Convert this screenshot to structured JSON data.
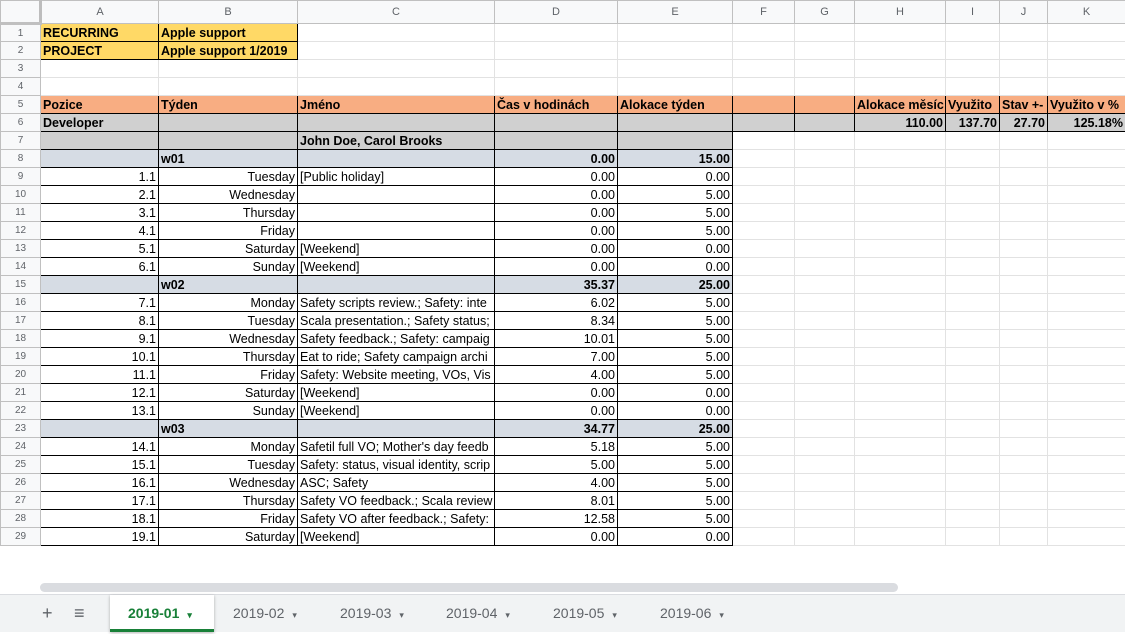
{
  "columns": [
    "A",
    "B",
    "C",
    "D",
    "E",
    "F",
    "G",
    "H",
    "I",
    "J",
    "K"
  ],
  "rows": [
    {
      "n": "1",
      "cells": [
        {
          "t": "RECURRING",
          "cls": "yel bx"
        },
        {
          "t": "Apple support",
          "cls": "yel bx"
        },
        {
          "t": ""
        },
        {
          "t": ""
        },
        {
          "t": ""
        },
        {
          "t": ""
        },
        {
          "t": ""
        },
        {
          "t": ""
        },
        {
          "t": ""
        },
        {
          "t": ""
        },
        {
          "t": ""
        }
      ]
    },
    {
      "n": "2",
      "cells": [
        {
          "t": "PROJECT",
          "cls": "yel bx"
        },
        {
          "t": "Apple support 1/2019",
          "cls": "yel bx"
        },
        {
          "t": ""
        },
        {
          "t": ""
        },
        {
          "t": ""
        },
        {
          "t": ""
        },
        {
          "t": ""
        },
        {
          "t": ""
        },
        {
          "t": ""
        },
        {
          "t": ""
        },
        {
          "t": ""
        }
      ]
    },
    {
      "n": "3",
      "cells": [
        {
          "t": ""
        },
        {
          "t": ""
        },
        {
          "t": ""
        },
        {
          "t": ""
        },
        {
          "t": ""
        },
        {
          "t": ""
        },
        {
          "t": ""
        },
        {
          "t": ""
        },
        {
          "t": ""
        },
        {
          "t": ""
        },
        {
          "t": ""
        }
      ]
    },
    {
      "n": "4",
      "cells": [
        {
          "t": ""
        },
        {
          "t": ""
        },
        {
          "t": ""
        },
        {
          "t": ""
        },
        {
          "t": ""
        },
        {
          "t": ""
        },
        {
          "t": ""
        },
        {
          "t": ""
        },
        {
          "t": ""
        },
        {
          "t": ""
        },
        {
          "t": ""
        }
      ]
    },
    {
      "n": "5",
      "cells": [
        {
          "t": "Pozice",
          "cls": "org bx"
        },
        {
          "t": "Týden",
          "cls": "org bx"
        },
        {
          "t": "Jméno",
          "cls": "org bx"
        },
        {
          "t": "Čas v hodinách",
          "cls": "org bx"
        },
        {
          "t": "Alokace týden",
          "cls": "org bx"
        },
        {
          "t": "",
          "cls": "org bx"
        },
        {
          "t": "",
          "cls": "org bx"
        },
        {
          "t": "Alokace měsíc",
          "cls": "org bx"
        },
        {
          "t": "Využito",
          "cls": "org bx"
        },
        {
          "t": "Stav +-",
          "cls": "org bx"
        },
        {
          "t": "Využito v %",
          "cls": "org bx"
        }
      ]
    },
    {
      "n": "6",
      "cells": [
        {
          "t": "Developer",
          "cls": "gry bx"
        },
        {
          "t": "",
          "cls": "gry bx"
        },
        {
          "t": "",
          "cls": "gry bx"
        },
        {
          "t": "",
          "cls": "gry bx"
        },
        {
          "t": "",
          "cls": "gry bx"
        },
        {
          "t": "",
          "cls": "gry bx"
        },
        {
          "t": "",
          "cls": "gry bx"
        },
        {
          "t": "110.00",
          "cls": "gry bx r"
        },
        {
          "t": "137.70",
          "cls": "gry bx r"
        },
        {
          "t": "27.70",
          "cls": "gry bx r"
        },
        {
          "t": "125.18%",
          "cls": "gry bx r"
        }
      ]
    },
    {
      "n": "7",
      "cells": [
        {
          "t": "",
          "cls": "gry bx"
        },
        {
          "t": "",
          "cls": "gry bx"
        },
        {
          "t": "John Doe, Carol Brooks",
          "cls": "gry bx"
        },
        {
          "t": "",
          "cls": "gry bx"
        },
        {
          "t": "",
          "cls": "gry bx"
        },
        {
          "t": ""
        },
        {
          "t": ""
        },
        {
          "t": ""
        },
        {
          "t": ""
        },
        {
          "t": ""
        },
        {
          "t": ""
        }
      ]
    },
    {
      "n": "8",
      "cells": [
        {
          "t": "",
          "cls": "wk bx"
        },
        {
          "t": "w01",
          "cls": "wk bx"
        },
        {
          "t": "",
          "cls": "wk bx"
        },
        {
          "t": "0.00",
          "cls": "wk bx r"
        },
        {
          "t": "15.00",
          "cls": "wk bx r"
        },
        {
          "t": ""
        },
        {
          "t": ""
        },
        {
          "t": ""
        },
        {
          "t": ""
        },
        {
          "t": ""
        },
        {
          "t": ""
        }
      ]
    },
    {
      "n": "9",
      "cells": [
        {
          "t": "1.1",
          "cls": "bx r"
        },
        {
          "t": "Tuesday",
          "cls": "bx r"
        },
        {
          "t": "[Public holiday]",
          "cls": "bx"
        },
        {
          "t": "0.00",
          "cls": "bx r"
        },
        {
          "t": "0.00",
          "cls": "bx r"
        },
        {
          "t": ""
        },
        {
          "t": ""
        },
        {
          "t": ""
        },
        {
          "t": ""
        },
        {
          "t": ""
        },
        {
          "t": ""
        }
      ]
    },
    {
      "n": "10",
      "cells": [
        {
          "t": "2.1",
          "cls": "bx r"
        },
        {
          "t": "Wednesday",
          "cls": "bx r"
        },
        {
          "t": "",
          "cls": "bx"
        },
        {
          "t": "0.00",
          "cls": "bx r"
        },
        {
          "t": "5.00",
          "cls": "bx r"
        },
        {
          "t": ""
        },
        {
          "t": ""
        },
        {
          "t": ""
        },
        {
          "t": ""
        },
        {
          "t": ""
        },
        {
          "t": ""
        }
      ]
    },
    {
      "n": "11",
      "cells": [
        {
          "t": "3.1",
          "cls": "bx r"
        },
        {
          "t": "Thursday",
          "cls": "bx r"
        },
        {
          "t": "",
          "cls": "bx"
        },
        {
          "t": "0.00",
          "cls": "bx r"
        },
        {
          "t": "5.00",
          "cls": "bx r"
        },
        {
          "t": ""
        },
        {
          "t": ""
        },
        {
          "t": ""
        },
        {
          "t": ""
        },
        {
          "t": ""
        },
        {
          "t": ""
        }
      ]
    },
    {
      "n": "12",
      "cells": [
        {
          "t": "4.1",
          "cls": "bx r"
        },
        {
          "t": "Friday",
          "cls": "bx r"
        },
        {
          "t": "",
          "cls": "bx"
        },
        {
          "t": "0.00",
          "cls": "bx r"
        },
        {
          "t": "5.00",
          "cls": "bx r"
        },
        {
          "t": ""
        },
        {
          "t": ""
        },
        {
          "t": ""
        },
        {
          "t": ""
        },
        {
          "t": ""
        },
        {
          "t": ""
        }
      ]
    },
    {
      "n": "13",
      "cells": [
        {
          "t": "5.1",
          "cls": "bx r"
        },
        {
          "t": "Saturday",
          "cls": "bx r"
        },
        {
          "t": "[Weekend]",
          "cls": "bx"
        },
        {
          "t": "0.00",
          "cls": "bx r"
        },
        {
          "t": "0.00",
          "cls": "bx r"
        },
        {
          "t": ""
        },
        {
          "t": ""
        },
        {
          "t": ""
        },
        {
          "t": ""
        },
        {
          "t": ""
        },
        {
          "t": ""
        }
      ]
    },
    {
      "n": "14",
      "cells": [
        {
          "t": "6.1",
          "cls": "bx r"
        },
        {
          "t": "Sunday",
          "cls": "bx r"
        },
        {
          "t": "[Weekend]",
          "cls": "bx"
        },
        {
          "t": "0.00",
          "cls": "bx r"
        },
        {
          "t": "0.00",
          "cls": "bx r"
        },
        {
          "t": ""
        },
        {
          "t": ""
        },
        {
          "t": ""
        },
        {
          "t": ""
        },
        {
          "t": ""
        },
        {
          "t": ""
        }
      ]
    },
    {
      "n": "15",
      "cells": [
        {
          "t": "",
          "cls": "wk bx"
        },
        {
          "t": "w02",
          "cls": "wk bx"
        },
        {
          "t": "",
          "cls": "wk bx"
        },
        {
          "t": "35.37",
          "cls": "wk bx r"
        },
        {
          "t": "25.00",
          "cls": "wk bx r"
        },
        {
          "t": ""
        },
        {
          "t": ""
        },
        {
          "t": ""
        },
        {
          "t": ""
        },
        {
          "t": ""
        },
        {
          "t": ""
        }
      ]
    },
    {
      "n": "16",
      "cells": [
        {
          "t": "7.1",
          "cls": "bx r"
        },
        {
          "t": "Monday",
          "cls": "bx r"
        },
        {
          "t": "Safety scripts review.; Safety: inte",
          "cls": "bx"
        },
        {
          "t": "6.02",
          "cls": "bx r"
        },
        {
          "t": "5.00",
          "cls": "bx r"
        },
        {
          "t": ""
        },
        {
          "t": ""
        },
        {
          "t": ""
        },
        {
          "t": ""
        },
        {
          "t": ""
        },
        {
          "t": ""
        }
      ]
    },
    {
      "n": "17",
      "cells": [
        {
          "t": "8.1",
          "cls": "bx r"
        },
        {
          "t": "Tuesday",
          "cls": "bx r"
        },
        {
          "t": "Scala presentation.; Safety status;",
          "cls": "bx"
        },
        {
          "t": "8.34",
          "cls": "bx r"
        },
        {
          "t": "5.00",
          "cls": "bx r"
        },
        {
          "t": ""
        },
        {
          "t": ""
        },
        {
          "t": ""
        },
        {
          "t": ""
        },
        {
          "t": ""
        },
        {
          "t": ""
        }
      ]
    },
    {
      "n": "18",
      "cells": [
        {
          "t": "9.1",
          "cls": "bx r"
        },
        {
          "t": "Wednesday",
          "cls": "bx r"
        },
        {
          "t": "Safety feedback.; Safety: campaig",
          "cls": "bx"
        },
        {
          "t": "10.01",
          "cls": "bx r"
        },
        {
          "t": "5.00",
          "cls": "bx r"
        },
        {
          "t": ""
        },
        {
          "t": ""
        },
        {
          "t": ""
        },
        {
          "t": ""
        },
        {
          "t": ""
        },
        {
          "t": ""
        }
      ]
    },
    {
      "n": "19",
      "cells": [
        {
          "t": "10.1",
          "cls": "bx r"
        },
        {
          "t": "Thursday",
          "cls": "bx r"
        },
        {
          "t": "Eat to ride; Safety campaign archi",
          "cls": "bx"
        },
        {
          "t": "7.00",
          "cls": "bx r"
        },
        {
          "t": "5.00",
          "cls": "bx r"
        },
        {
          "t": ""
        },
        {
          "t": ""
        },
        {
          "t": ""
        },
        {
          "t": ""
        },
        {
          "t": ""
        },
        {
          "t": ""
        }
      ]
    },
    {
      "n": "20",
      "cells": [
        {
          "t": "11.1",
          "cls": "bx r"
        },
        {
          "t": "Friday",
          "cls": "bx r"
        },
        {
          "t": "Safety: Website meeting, VOs, Vis",
          "cls": "bx"
        },
        {
          "t": "4.00",
          "cls": "bx r"
        },
        {
          "t": "5.00",
          "cls": "bx r"
        },
        {
          "t": ""
        },
        {
          "t": ""
        },
        {
          "t": ""
        },
        {
          "t": ""
        },
        {
          "t": ""
        },
        {
          "t": ""
        }
      ]
    },
    {
      "n": "21",
      "cells": [
        {
          "t": "12.1",
          "cls": "bx r"
        },
        {
          "t": "Saturday",
          "cls": "bx r"
        },
        {
          "t": "[Weekend]",
          "cls": "bx"
        },
        {
          "t": "0.00",
          "cls": "bx r"
        },
        {
          "t": "0.00",
          "cls": "bx r"
        },
        {
          "t": ""
        },
        {
          "t": ""
        },
        {
          "t": ""
        },
        {
          "t": ""
        },
        {
          "t": ""
        },
        {
          "t": ""
        }
      ]
    },
    {
      "n": "22",
      "cells": [
        {
          "t": "13.1",
          "cls": "bx r"
        },
        {
          "t": "Sunday",
          "cls": "bx r"
        },
        {
          "t": "[Weekend]",
          "cls": "bx"
        },
        {
          "t": "0.00",
          "cls": "bx r"
        },
        {
          "t": "0.00",
          "cls": "bx r"
        },
        {
          "t": ""
        },
        {
          "t": ""
        },
        {
          "t": ""
        },
        {
          "t": ""
        },
        {
          "t": ""
        },
        {
          "t": ""
        }
      ]
    },
    {
      "n": "23",
      "cells": [
        {
          "t": "",
          "cls": "wk bx"
        },
        {
          "t": "w03",
          "cls": "wk bx"
        },
        {
          "t": "",
          "cls": "wk bx"
        },
        {
          "t": "34.77",
          "cls": "wk bx r"
        },
        {
          "t": "25.00",
          "cls": "wk bx r"
        },
        {
          "t": ""
        },
        {
          "t": ""
        },
        {
          "t": ""
        },
        {
          "t": ""
        },
        {
          "t": ""
        },
        {
          "t": ""
        }
      ]
    },
    {
      "n": "24",
      "cells": [
        {
          "t": "14.1",
          "cls": "bx r"
        },
        {
          "t": "Monday",
          "cls": "bx r"
        },
        {
          "t": "Safetil full VO; Mother's day feedb",
          "cls": "bx"
        },
        {
          "t": "5.18",
          "cls": "bx r"
        },
        {
          "t": "5.00",
          "cls": "bx r"
        },
        {
          "t": ""
        },
        {
          "t": ""
        },
        {
          "t": ""
        },
        {
          "t": ""
        },
        {
          "t": ""
        },
        {
          "t": ""
        }
      ]
    },
    {
      "n": "25",
      "cells": [
        {
          "t": "15.1",
          "cls": "bx r"
        },
        {
          "t": "Tuesday",
          "cls": "bx r"
        },
        {
          "t": "Safety: status, visual identity, scrip",
          "cls": "bx"
        },
        {
          "t": "5.00",
          "cls": "bx r"
        },
        {
          "t": "5.00",
          "cls": "bx r"
        },
        {
          "t": ""
        },
        {
          "t": ""
        },
        {
          "t": ""
        },
        {
          "t": ""
        },
        {
          "t": ""
        },
        {
          "t": ""
        }
      ]
    },
    {
      "n": "26",
      "cells": [
        {
          "t": "16.1",
          "cls": "bx r"
        },
        {
          "t": "Wednesday",
          "cls": "bx r"
        },
        {
          "t": "ASC; Safety",
          "cls": "bx"
        },
        {
          "t": "4.00",
          "cls": "bx r"
        },
        {
          "t": "5.00",
          "cls": "bx r"
        },
        {
          "t": ""
        },
        {
          "t": ""
        },
        {
          "t": ""
        },
        {
          "t": ""
        },
        {
          "t": ""
        },
        {
          "t": ""
        }
      ]
    },
    {
      "n": "27",
      "cells": [
        {
          "t": "17.1",
          "cls": "bx r"
        },
        {
          "t": "Thursday",
          "cls": "bx r"
        },
        {
          "t": "Safety VO feedback.; Scala review",
          "cls": "bx"
        },
        {
          "t": "8.01",
          "cls": "bx r"
        },
        {
          "t": "5.00",
          "cls": "bx r"
        },
        {
          "t": ""
        },
        {
          "t": ""
        },
        {
          "t": ""
        },
        {
          "t": ""
        },
        {
          "t": ""
        },
        {
          "t": ""
        }
      ]
    },
    {
      "n": "28",
      "cells": [
        {
          "t": "18.1",
          "cls": "bx r"
        },
        {
          "t": "Friday",
          "cls": "bx r"
        },
        {
          "t": "Safety VO after feedback.; Safety:",
          "cls": "bx"
        },
        {
          "t": "12.58",
          "cls": "bx r"
        },
        {
          "t": "5.00",
          "cls": "bx r"
        },
        {
          "t": ""
        },
        {
          "t": ""
        },
        {
          "t": ""
        },
        {
          "t": ""
        },
        {
          "t": ""
        },
        {
          "t": ""
        }
      ]
    },
    {
      "n": "29",
      "cells": [
        {
          "t": "19.1",
          "cls": "bx r"
        },
        {
          "t": "Saturday",
          "cls": "bx r"
        },
        {
          "t": "[Weekend]",
          "cls": "bx"
        },
        {
          "t": "0.00",
          "cls": "bx r"
        },
        {
          "t": "0.00",
          "cls": "bx r"
        },
        {
          "t": ""
        },
        {
          "t": ""
        },
        {
          "t": ""
        },
        {
          "t": ""
        },
        {
          "t": ""
        },
        {
          "t": ""
        }
      ]
    }
  ],
  "tabbar": {
    "add_icon": "+",
    "list_icon": "≡",
    "active_tab": "2019-01",
    "tabs": [
      "2019-01",
      "2019-02",
      "2019-03",
      "2019-04",
      "2019-05",
      "2019-06"
    ],
    "caret": "▾",
    "accent": "#188038"
  }
}
